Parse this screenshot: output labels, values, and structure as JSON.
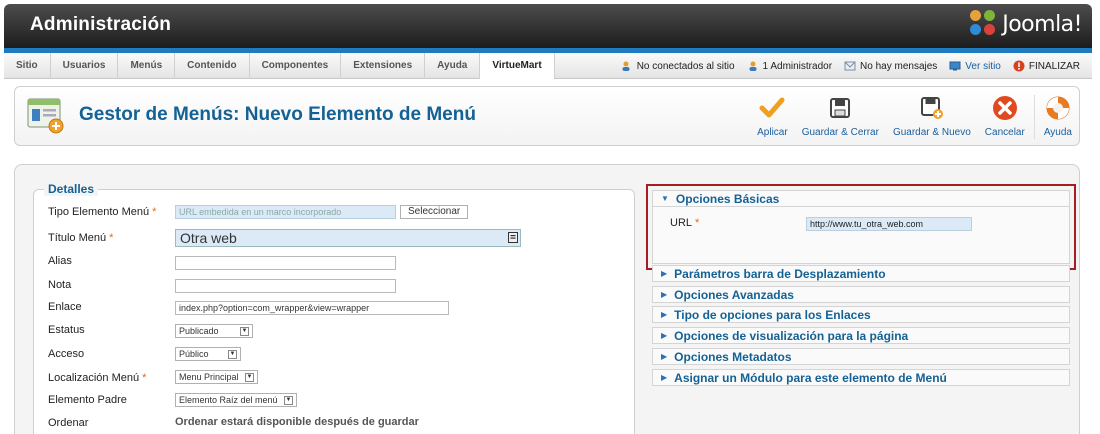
{
  "header": {
    "title": "Administración",
    "logo_text": "Joomla!"
  },
  "menu": {
    "items": [
      "Sitio",
      "Usuarios",
      "Menús",
      "Contenido",
      "Componentes",
      "Extensiones",
      "Ayuda",
      "VirtueMart"
    ],
    "active_index": 7
  },
  "status": {
    "not_connected": "No conectados al sitio",
    "admins": "1 Administrador",
    "messages": "No hay mensajes",
    "view_site": "Ver sitio",
    "logout": "FINALIZAR"
  },
  "page": {
    "title": "Gestor de Menús: Nuevo Elemento de Menú"
  },
  "toolbar": {
    "apply": "Aplicar",
    "save_close": "Guardar & Cerrar",
    "save_new": "Guardar & Nuevo",
    "cancel": "Cancelar",
    "help": "Ayuda"
  },
  "details": {
    "legend": "Detalles",
    "type_label": "Tipo Elemento Menú",
    "type_placeholder": "URL embedida en un marco incorporado",
    "select_button": "Seleccionar",
    "title_label": "Título Menú",
    "title_value": "Otra web",
    "alias_label": "Alias",
    "alias_value": "",
    "note_label": "Nota",
    "note_value": "",
    "link_label": "Enlace",
    "link_value": "index.php?option=com_wrapper&view=wrapper",
    "status_label": "Estatus",
    "status_value": "Publicado",
    "access_label": "Acceso",
    "access_value": "Público",
    "location_label": "Localización Menú",
    "location_value": "Menu Principal",
    "parent_label": "Elemento Padre",
    "parent_value": "Elemento Raíz del menú",
    "order_label": "Ordenar",
    "order_text": "Ordenar estará disponible después de guardar",
    "required_mark": "*"
  },
  "options": {
    "basic_title": "Opciones Básicas",
    "url_label": "URL",
    "url_value": "http://www.tu_otra_web.com",
    "panels": [
      "Parámetros barra de Desplazamiento",
      "Opciones Avanzadas",
      "Tipo de opciones para los Enlaces",
      "Opciones de visualización para la página",
      "Opciones Metadatos",
      "Asignar un Módulo para este elemento de Menú"
    ]
  },
  "colors": {
    "accent": "#146295",
    "header_blue": "#1f7bbf",
    "highlight_frame": "#a41c24",
    "required": "#e06a1a"
  }
}
